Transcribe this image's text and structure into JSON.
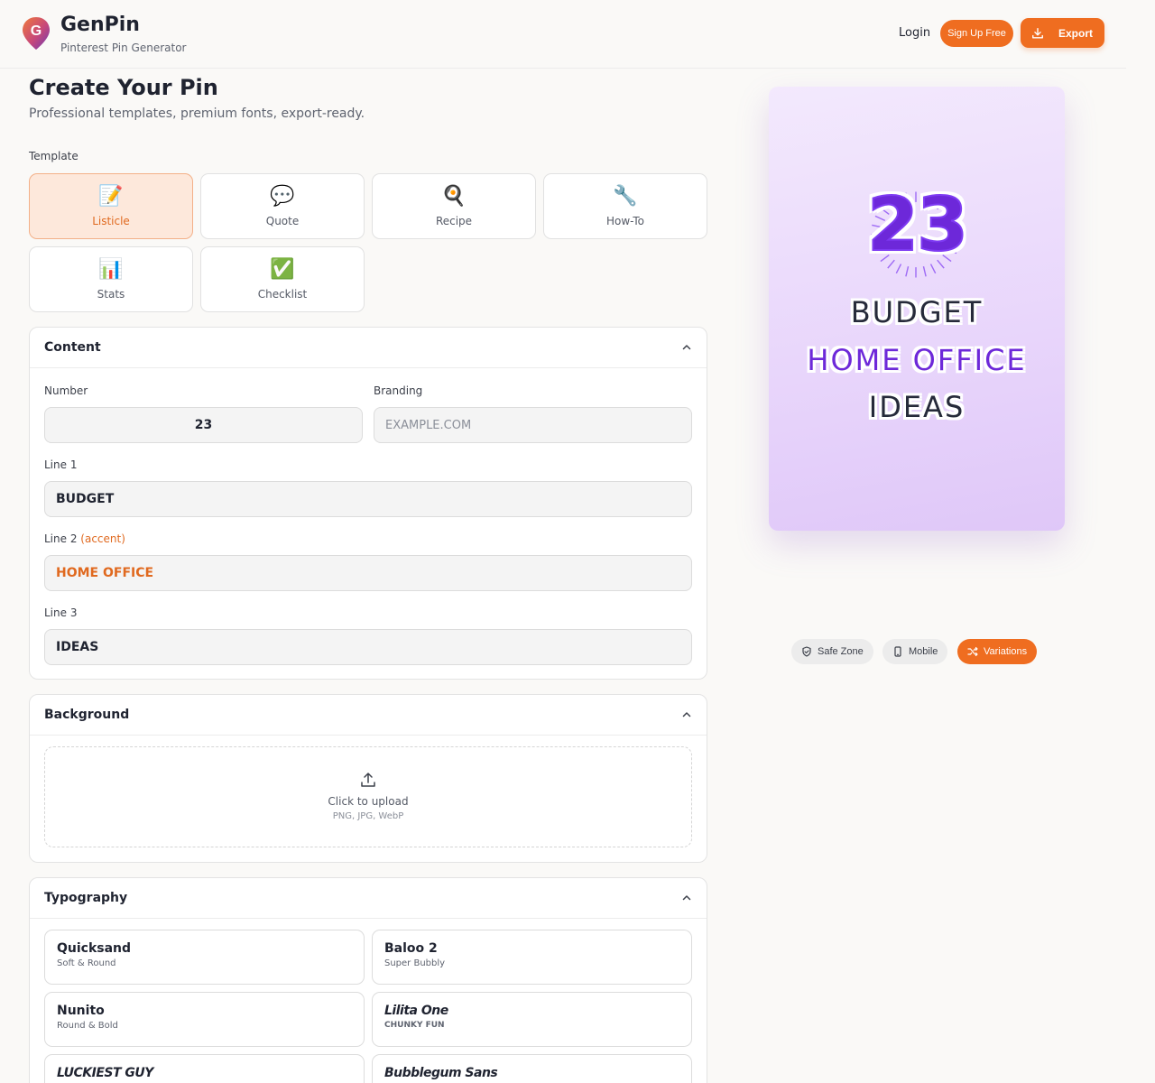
{
  "header": {
    "logo_letter": "G",
    "brand_name": "GenPin",
    "brand_sub": "Pinterest Pin Generator",
    "login_label": "Login",
    "signup_label": "Sign Up Free",
    "export_label": "Export"
  },
  "page": {
    "title": "Create Your Pin",
    "subtitle": "Professional templates, premium fonts, export-ready."
  },
  "templates": {
    "label": "Template",
    "items": [
      {
        "emoji": "📝",
        "label": "Listicle",
        "active": true
      },
      {
        "emoji": "💬",
        "label": "Quote"
      },
      {
        "emoji": "🍳",
        "label": "Recipe"
      },
      {
        "emoji": "🔧",
        "label": "How-To"
      },
      {
        "emoji": "📊",
        "label": "Stats"
      },
      {
        "emoji": "✅",
        "label": "Checklist"
      }
    ]
  },
  "content": {
    "title": "Content",
    "number_label": "Number",
    "number_value": "23",
    "branding_label": "Branding",
    "branding_placeholder": "EXAMPLE.COM",
    "line1_label": "Line 1",
    "line1_value": "BUDGET",
    "line2_label": "Line 2",
    "line2_accent": "(accent)",
    "line2_value": "HOME OFFICE",
    "line3_label": "Line 3",
    "line3_value": "IDEAS"
  },
  "background": {
    "title": "Background",
    "upload_label": "Click to upload",
    "upload_formats": "PNG, JPG, WebP"
  },
  "typography": {
    "title": "Typography",
    "fonts": [
      {
        "name": "Quicksand",
        "desc": "Soft & Round"
      },
      {
        "name": "Baloo 2",
        "desc": "Super Bubbly"
      },
      {
        "name": "Nunito",
        "desc": "Round & Bold"
      },
      {
        "name": "Lilita One",
        "desc": "CHUNKY FUN"
      },
      {
        "name": "LUCKIEST GUY",
        "desc": ""
      },
      {
        "name": "Bubblegum Sans",
        "desc": ""
      }
    ]
  },
  "preview": {
    "number": "23",
    "line1": "BUDGET",
    "line2": "HOME OFFICE",
    "line3": "IDEAS"
  },
  "toolbar": {
    "safe_zone": "Safe Zone",
    "mobile": "Mobile",
    "variations": "Variations"
  },
  "colors": {
    "accent": "#ef6d20",
    "preview_purple": "#6d28d9"
  }
}
